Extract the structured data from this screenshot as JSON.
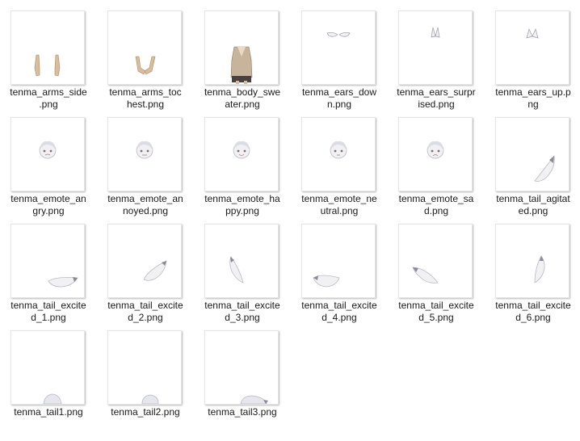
{
  "files": [
    {
      "name": "tenma_arms_side.png",
      "line1": "tenma_arms_side",
      "line2": ".png",
      "icon": "arms-side-thumbnail"
    },
    {
      "name": "tenma_arms_tochest.png",
      "line1": "tenma_arms_toc",
      "line2": "hest.png",
      "icon": "arms-tochest-thumbnail"
    },
    {
      "name": "tenma_body_sweater.png",
      "line1": "tenma_body_swe",
      "line2": "ater.png",
      "icon": "body-sweater-thumbnail"
    },
    {
      "name": "tenma_ears_down.png",
      "line1": "tenma_ears_dow",
      "line2": "n.png",
      "icon": "ears-down-thumbnail"
    },
    {
      "name": "tenma_ears_surprised.png",
      "line1": "tenma_ears_surpr",
      "line2": "ised.png",
      "icon": "ears-surprised-thumbnail"
    },
    {
      "name": "tenma_ears_up.png",
      "line1": "tenma_ears_up.p",
      "line2": "ng",
      "icon": "ears-up-thumbnail"
    },
    {
      "name": "tenma_emote_angry.png",
      "line1": "tenma_emote_an",
      "line2": "gry.png",
      "icon": "emote-face-thumbnail"
    },
    {
      "name": "tenma_emote_annoyed.png",
      "line1": "tenma_emote_an",
      "line2": "noyed.png",
      "icon": "emote-face-thumbnail"
    },
    {
      "name": "tenma_emote_happy.png",
      "line1": "tenma_emote_ha",
      "line2": "ppy.png",
      "icon": "emote-face-thumbnail"
    },
    {
      "name": "tenma_emote_neutral.png",
      "line1": "tenma_emote_ne",
      "line2": "utral.png",
      "icon": "emote-face-thumbnail"
    },
    {
      "name": "tenma_emote_sad.png",
      "line1": "tenma_emote_sa",
      "line2": "d.png",
      "icon": "emote-face-thumbnail"
    },
    {
      "name": "tenma_tail_agitated.png",
      "line1": "tenma_tail_agitat",
      "line2": "ed.png",
      "icon": "tail-thumbnail"
    },
    {
      "name": "tenma_tail_excited_1.png",
      "line1": "tenma_tail_excite",
      "line2": "d_1.png",
      "icon": "tail-thumbnail"
    },
    {
      "name": "tenma_tail_excited_2.png",
      "line1": "tenma_tail_excite",
      "line2": "d_2.png",
      "icon": "tail-thumbnail"
    },
    {
      "name": "tenma_tail_excited_3.png",
      "line1": "tenma_tail_excite",
      "line2": "d_3.png",
      "icon": "tail-thumbnail"
    },
    {
      "name": "tenma_tail_excited_4.png",
      "line1": "tenma_tail_excite",
      "line2": "d_4.png",
      "icon": "tail-thumbnail"
    },
    {
      "name": "tenma_tail_excited_5.png",
      "line1": "tenma_tail_excite",
      "line2": "d_5.png",
      "icon": "tail-thumbnail"
    },
    {
      "name": "tenma_tail_excited_6.png",
      "line1": "tenma_tail_excite",
      "line2": "d_6.png",
      "icon": "tail-thumbnail"
    },
    {
      "name": "tenma_tail1.png",
      "line1": "tenma_tail1.png",
      "line2": "",
      "icon": "tail-thumbnail"
    },
    {
      "name": "tenma_tail2.png",
      "line1": "tenma_tail2.png",
      "line2": "",
      "icon": "tail-thumbnail"
    },
    {
      "name": "tenma_tail3.png",
      "line1": "tenma_tail3.png",
      "line2": "",
      "icon": "tail-thumbnail"
    }
  ],
  "colors": {
    "skin": "#d9bd9c",
    "fur": "#f1f1f4",
    "fur_shade": "#b9b9c4",
    "sweater": "#c7b49a",
    "dark": "#4a4040"
  }
}
